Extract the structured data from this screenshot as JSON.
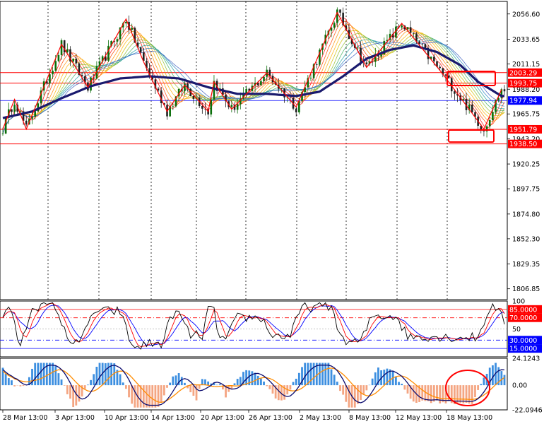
{
  "chart_data": [
    {
      "type": "candlestick",
      "panel": "price",
      "yticks": [
        "2056.60",
        "2033.65",
        "2011.15",
        "1988.20",
        "1965.75",
        "1943.20",
        "1920.25",
        "1897.75",
        "1874.80",
        "1852.30",
        "1829.35",
        "1806.85"
      ],
      "ytick_values": [
        2056.6,
        2033.65,
        2011.15,
        1988.2,
        1965.75,
        1943.2,
        1920.25,
        1897.75,
        1874.8,
        1852.3,
        1829.35,
        1806.85
      ],
      "ylim": [
        1797,
        2068
      ],
      "hlines": [
        {
          "value": 2003.29,
          "label": "2003.29",
          "color": "#ff0000"
        },
        {
          "value": 1993.75,
          "label": "1993.75",
          "color": "#ff0000"
        },
        {
          "value": 1977.94,
          "label": "1977.94",
          "color": "#0000ff"
        },
        {
          "value": 1951.79,
          "label": "1951.79",
          "color": "#ff0000"
        },
        {
          "value": 1938.5,
          "label": "1938.50",
          "color": "#ff0000"
        }
      ],
      "current_price": "1977.94",
      "zigzag": [
        [
          0,
          1952
        ],
        [
          4,
          1979
        ],
        [
          8,
          1952
        ],
        [
          20,
          2029
        ],
        [
          29,
          1990
        ],
        [
          42,
          2052
        ],
        [
          48,
          2013
        ],
        [
          56,
          1968
        ],
        [
          62,
          1992
        ],
        [
          70,
          1968
        ],
        [
          72,
          1995
        ],
        [
          78,
          1970
        ],
        [
          90,
          2003
        ],
        [
          100,
          1972
        ],
        [
          114,
          2058
        ],
        [
          124,
          2008
        ],
        [
          136,
          2048
        ],
        [
          150,
          2002
        ],
        [
          164,
          1952
        ],
        [
          170,
          1988
        ]
      ],
      "ma_thick": [
        [
          0,
          1962
        ],
        [
          10,
          1968
        ],
        [
          20,
          1980
        ],
        [
          30,
          1991
        ],
        [
          40,
          1998
        ],
        [
          50,
          2000
        ],
        [
          60,
          1998
        ],
        [
          70,
          1990
        ],
        [
          80,
          1984
        ],
        [
          90,
          1984
        ],
        [
          100,
          1982
        ],
        [
          108,
          1986
        ],
        [
          116,
          2000
        ],
        [
          124,
          2016
        ],
        [
          132,
          2024
        ],
        [
          140,
          2028
        ],
        [
          148,
          2022
        ],
        [
          156,
          2010
        ],
        [
          162,
          1995
        ],
        [
          170,
          1982
        ]
      ]
    },
    {
      "type": "line",
      "panel": "oscillator",
      "yticks": [
        "100",
        "85.0000",
        "70.0000",
        "50",
        "30.0000",
        "15.0000"
      ],
      "ytick_values": [
        100,
        85,
        70,
        50,
        30,
        15
      ],
      "ylim": [
        0,
        100
      ],
      "levels": [
        85,
        70,
        30,
        15
      ]
    },
    {
      "type": "histogram",
      "panel": "macd",
      "yticks": [
        "24.1243",
        "0.00",
        "-22.0946"
      ],
      "ytick_values": [
        24.1243,
        0,
        -22.0946
      ],
      "ylim": [
        -22.0946,
        24.1243
      ]
    }
  ],
  "x_labels": [
    "28 Mar 13:00",
    "3 Apr 13:00",
    "10 Apr 13:00",
    "14 Apr 13:00",
    "20 Apr 13:00",
    "26 Apr 13:00",
    "2 May 13:00",
    "8 May 13:00",
    "12 May 13:00",
    "18 May 13:00"
  ],
  "colors": {
    "zigzag": "#ff0000",
    "ma_thick": "#1a1a6e",
    "up_candle": "#0a6e0a",
    "down_candle": "#202020",
    "osc_black": "#000000",
    "osc_red": "#ff0000",
    "osc_blue": "#0000ff",
    "macd_pos": "#3d8fe0",
    "macd_neg": "#f4a582",
    "macd_orange": "#ff8c00",
    "macd_navy": "#0a0a6e"
  }
}
